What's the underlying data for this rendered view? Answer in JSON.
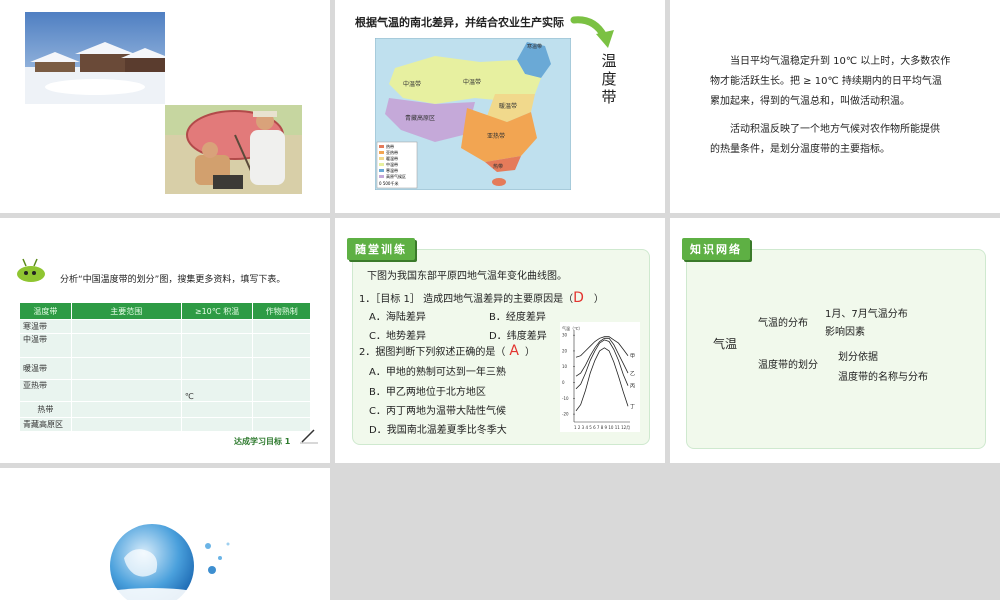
{
  "slide1": {
    "photo_top_desc": "",
    "photo_bottom_desc": ""
  },
  "slide2": {
    "heading": "根据气温的南北差异，并结合农业生产实际",
    "zone_label_chars": [
      "温",
      "度",
      "带"
    ],
    "map_regions": [
      "寒温带",
      "中温带",
      "暖温带",
      "亚热带",
      "热带",
      "青藏高原区"
    ],
    "map_legend": [
      "热带",
      "亚热带",
      "暖温带",
      "中温带",
      "寒温带",
      "高原气候区"
    ],
    "map_scale": "0     500千米",
    "colors": {
      "arrow": "#7bc143",
      "map_blue": "#bfe0ee"
    }
  },
  "slide3": {
    "para1": "当日平均气温稳定升到 10℃ 以上时，大多数农作物才能活跃生长。把 ≥ 10℃ 持续期内的日平均气温累加起来，得到的气温总和，叫做活动积温。",
    "para1_lines": [
      "当日平均气温稳定升到 10℃ 以上时，大多数农作",
      "物才能活跃生长。把 ≥ 10℃ 持续期内的日平均气温",
      "累加起来，得到的气温总和，叫做活动积温。"
    ],
    "para2_lines": [
      "活动积温反映了一个地方气候对农作物所能提供",
      "的热量条件，是划分温度带的主要指标。"
    ]
  },
  "slide4": {
    "instruction": "分析“中国温度带的划分”图，搜集更多资料，填写下表。",
    "headers": [
      "温度带",
      "主要范围",
      "≥10℃ 积温",
      "作物熟制"
    ],
    "rows": [
      "寒温带",
      "中温带",
      "暖温带",
      "亚热带",
      "热带",
      "青藏高原区"
    ],
    "unit_cell": "℃",
    "footer": "达成学习目标  1"
  },
  "slide5": {
    "tag": "随堂训练",
    "intro": "下图为我国东部平原四地气温年变化曲线图。",
    "q1": "1．［目标 1］ 造成四地气温差异的主要原因是（",
    "q1_answer": "D",
    "q1_close": "）",
    "q1_options": [
      "A．海陆差异",
      "B．经度差异",
      "C．地势差异",
      "D．纬度差异"
    ],
    "q2": "2．据图判断下列叙述正确的是（",
    "q2_answer": "A",
    "q2_close": "）",
    "q2_options": [
      "A．甲地的熟制可达到一年三熟",
      "B．甲乙两地位于北方地区",
      "C．丙丁两地为温带大陆性气候",
      "D．我国南北温差夏季比冬季大"
    ],
    "chart_ylabel": "气温（℃）",
    "chart_yticks": [
      "30",
      "20",
      "10",
      "0",
      "-10",
      "-20"
    ],
    "chart_xticks": "1 2 3 4 5 6 7 8 9 10 11 12月",
    "curve_labels": [
      "甲",
      "乙",
      "丙",
      "丁"
    ],
    "colors": {
      "answer": "#e3342f"
    }
  },
  "slide6": {
    "tag": "知识网络",
    "root": "气温",
    "branch1": "气温的分布",
    "branch1_items": [
      "1月、7月气温分布",
      "影响因素"
    ],
    "branch2": "温度带的划分",
    "branch2_items": [
      "划分依据",
      "温度带的名称与分布"
    ]
  },
  "slide7": {
    "globe_desc": ""
  },
  "chart_data": {
    "type": "line",
    "x": [
      1,
      2,
      3,
      4,
      5,
      6,
      7,
      8,
      9,
      10,
      11,
      12
    ],
    "series": [
      {
        "name": "甲",
        "values": [
          16,
          17,
          20,
          23,
          26,
          28,
          29,
          29,
          27,
          25,
          21,
          17
        ]
      },
      {
        "name": "乙",
        "values": [
          4,
          6,
          11,
          17,
          22,
          26,
          28,
          28,
          24,
          18,
          12,
          6
        ]
      },
      {
        "name": "丙",
        "values": [
          -4,
          -1,
          6,
          14,
          20,
          25,
          27,
          26,
          21,
          14,
          5,
          -2
        ]
      },
      {
        "name": "丁",
        "values": [
          -18,
          -14,
          -5,
          6,
          14,
          20,
          22,
          20,
          13,
          4,
          -6,
          -15
        ]
      }
    ],
    "ylim": [
      -25,
      32
    ]
  }
}
